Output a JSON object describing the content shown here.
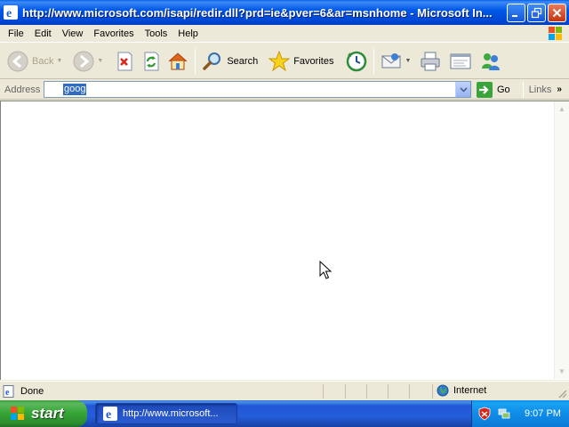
{
  "window": {
    "title": "http://www.microsoft.com/isapi/redir.dll?prd=ie&pver=6&ar=msnhome - Microsoft In..."
  },
  "menu": [
    "File",
    "Edit",
    "View",
    "Favorites",
    "Tools",
    "Help"
  ],
  "toolbar": {
    "back_label": "Back",
    "search_label": "Search",
    "favorites_label": "Favorites"
  },
  "address": {
    "label": "Address",
    "value": "goog",
    "go_label": "Go",
    "links_label": "Links"
  },
  "status": {
    "text": "Done",
    "zone": "Internet"
  },
  "taskbar": {
    "start_label": "start",
    "task_label": "http://www.microsoft...",
    "clock": "9:07 PM"
  },
  "colors": {
    "titlebar": "#0058E6",
    "selection": "#316AC5",
    "start_green": "#37A737"
  }
}
